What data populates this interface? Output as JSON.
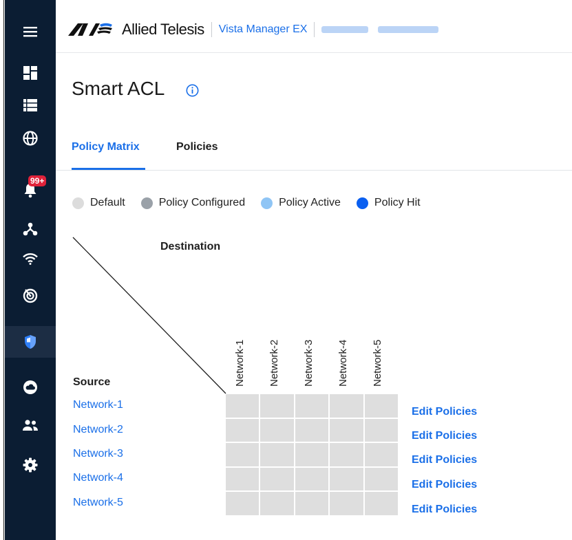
{
  "sidebar": {
    "items": [
      {
        "name": "menu-icon"
      },
      {
        "name": "dashboard-icon"
      },
      {
        "name": "list-icon"
      },
      {
        "name": "globe-icon"
      },
      {
        "name": "notifications-icon"
      },
      {
        "name": "topology-icon"
      },
      {
        "name": "wifi-icon"
      },
      {
        "name": "radar-icon"
      },
      {
        "name": "shield-icon"
      },
      {
        "name": "cloud-icon"
      },
      {
        "name": "users-icon"
      },
      {
        "name": "settings-icon"
      }
    ],
    "notification_badge": "99+",
    "active_item": "shield-icon"
  },
  "header": {
    "brand_name": "Allied Telesis",
    "product_name": "Vista Manager EX"
  },
  "page": {
    "title": "Smart ACL"
  },
  "tabs": [
    {
      "label": "Policy Matrix",
      "active": true
    },
    {
      "label": "Policies",
      "active": false
    }
  ],
  "legend": [
    {
      "label": "Default",
      "color": "#dcdcdc"
    },
    {
      "label": "Policy Configured",
      "color": "#9aa1a8"
    },
    {
      "label": "Policy Active",
      "color": "#8fc5f5"
    },
    {
      "label": "Policy Hit",
      "color": "#0a5ff0"
    }
  ],
  "matrix": {
    "destination_label": "Destination",
    "source_label": "Source",
    "columns": [
      "Network-1",
      "Network-2",
      "Network-3",
      "Network-4",
      "Network-5"
    ],
    "rows": [
      "Network-1",
      "Network-2",
      "Network-3",
      "Network-4",
      "Network-5"
    ],
    "edit_link_label": "Edit Policies",
    "cell_color": "#dedede"
  },
  "colors": {
    "accent": "#1a6fe8",
    "sidebar_bg": "#0b1d33"
  }
}
